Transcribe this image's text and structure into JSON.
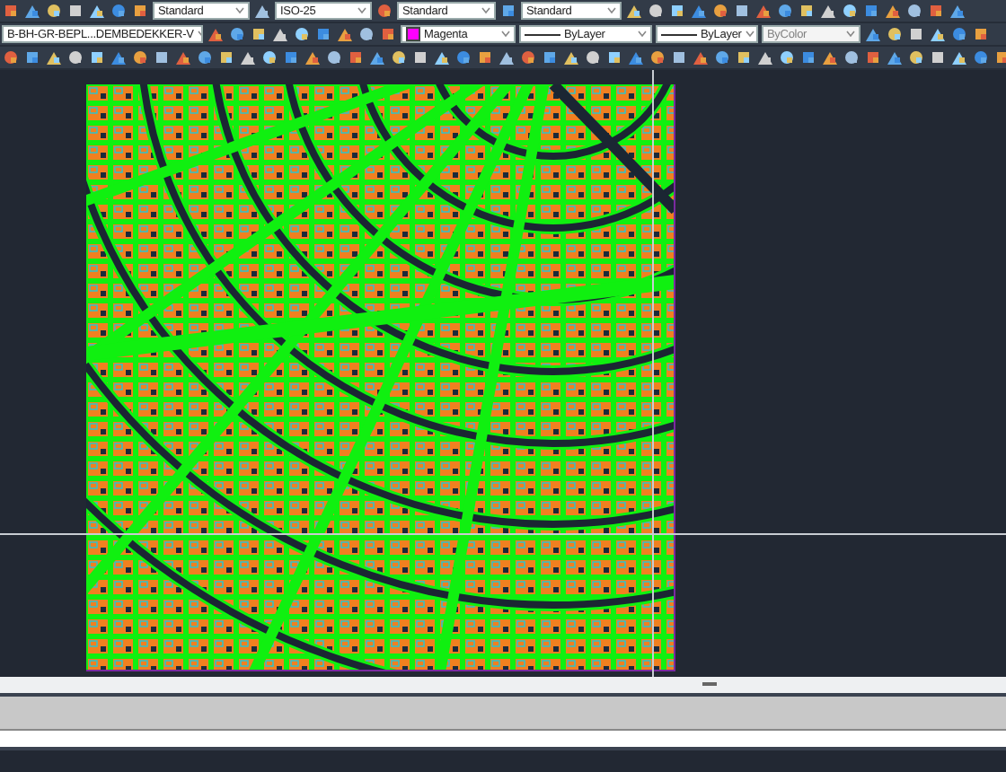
{
  "toolbars": [
    {
      "combos": [
        {
          "value": "Standard"
        },
        {
          "value": "ISO-25"
        },
        {
          "value": "Standard"
        },
        {
          "value": "Standard"
        }
      ]
    },
    {
      "combos": [
        {
          "value": "B-BH-GR-BEPL...DEMBEDEKKER-V"
        },
        {
          "value": "Magenta",
          "color": "#ff00ff"
        },
        {
          "value": "ByLayer",
          "kind": "line"
        },
        {
          "value": "ByLayer",
          "kind": "line"
        },
        {
          "value": "ByColor",
          "disabled": true
        }
      ]
    }
  ]
}
